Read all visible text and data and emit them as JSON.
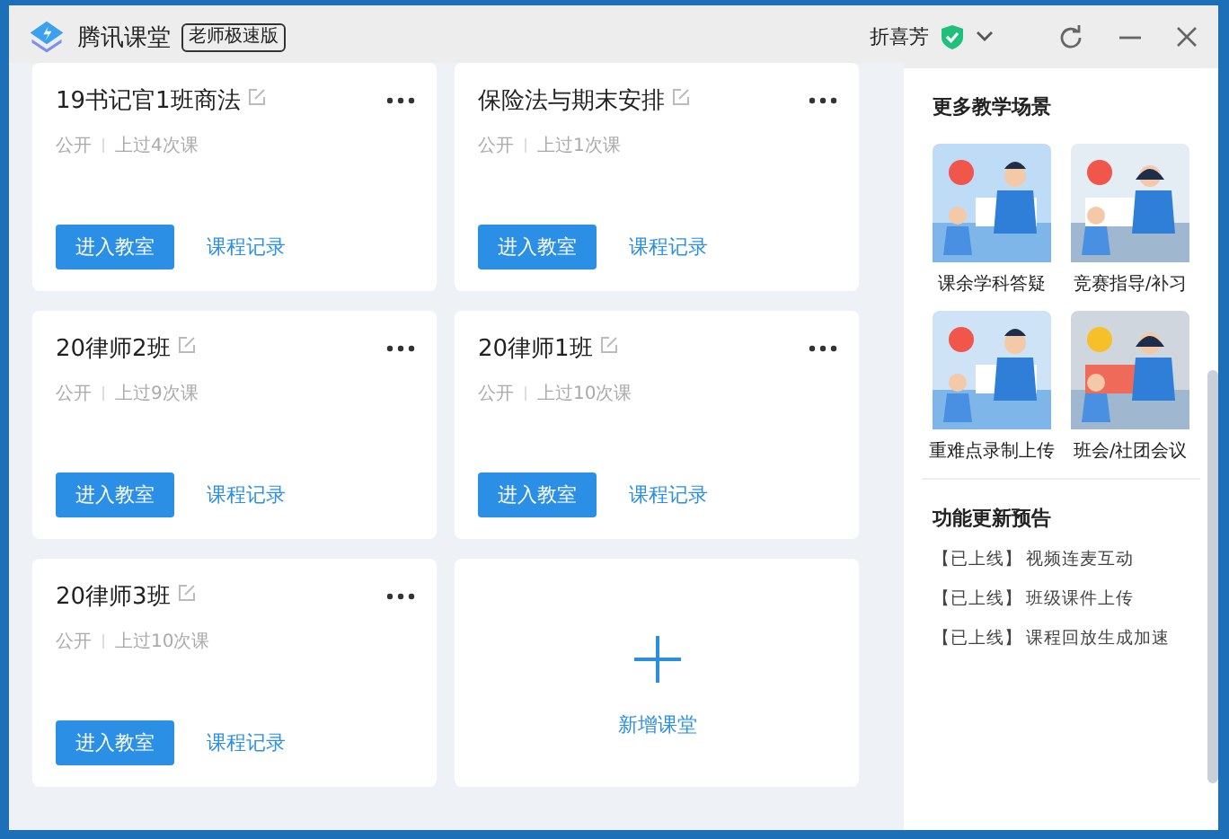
{
  "window": {
    "title": "腾讯课堂",
    "edition_badge": "老师极速版",
    "user": "折喜芳"
  },
  "classes": [
    {
      "kind": "class",
      "name": "19书记官1班商法",
      "visibility": "公开",
      "history": "上过4次课",
      "enter": "进入教室",
      "records": "课程记录"
    },
    {
      "kind": "class",
      "name": "保险法与期末安排",
      "visibility": "公开",
      "history": "上过1次课",
      "enter": "进入教室",
      "records": "课程记录"
    },
    {
      "kind": "class",
      "name": "20律师2班",
      "visibility": "公开",
      "history": "上过9次课",
      "enter": "进入教室",
      "records": "课程记录"
    },
    {
      "kind": "class",
      "name": "20律师1班",
      "visibility": "公开",
      "history": "上过10次课",
      "enter": "进入教室",
      "records": "课程记录"
    },
    {
      "kind": "class",
      "name": "20律师3班",
      "visibility": "公开",
      "history": "上过10次课",
      "enter": "进入教室",
      "records": "课程记录"
    },
    {
      "kind": "add",
      "label": "新增课堂"
    }
  ],
  "more_scenes": {
    "title": "更多教学场景",
    "items": [
      {
        "label": "课余学科答疑"
      },
      {
        "label": "竞赛指导/补习"
      },
      {
        "label": "重难点录制上传"
      },
      {
        "label": "班会/社团会议"
      }
    ]
  },
  "updates": {
    "title": "功能更新预告",
    "items": [
      {
        "tag": "【已上线】",
        "text": "视频连麦互动"
      },
      {
        "tag": "【已上线】",
        "text": "班级课件上传"
      },
      {
        "tag": "【已上线】",
        "text": "课程回放生成加速"
      }
    ]
  }
}
